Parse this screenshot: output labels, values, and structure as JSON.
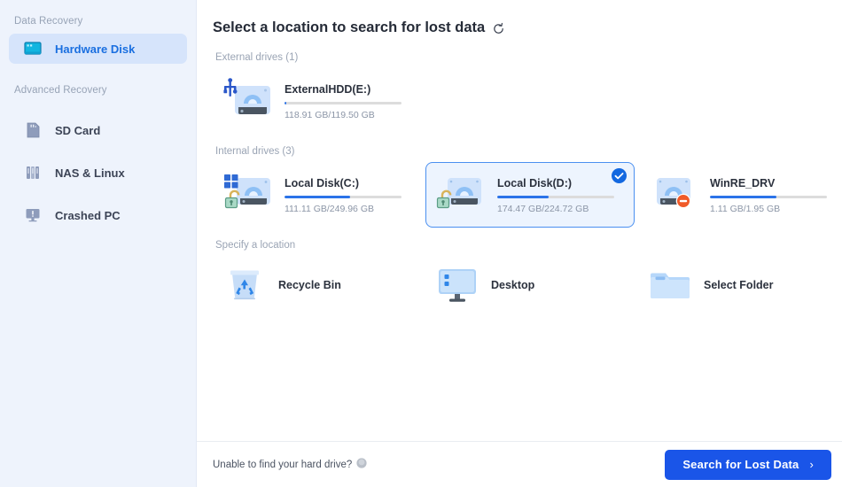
{
  "sidebar": {
    "groups": [
      {
        "label": "Data Recovery",
        "items": [
          {
            "label": "Hardware Disk",
            "icon": "hard-disk-icon",
            "active": true
          }
        ]
      },
      {
        "label": "Advanced Recovery",
        "items": [
          {
            "label": "SD Card",
            "icon": "sd-card-icon",
            "active": false
          },
          {
            "label": "NAS & Linux",
            "icon": "nas-icon",
            "active": false
          },
          {
            "label": "Crashed PC",
            "icon": "crashed-pc-icon",
            "active": false
          }
        ]
      }
    ]
  },
  "main": {
    "title": "Select a location to search for lost data",
    "refresh_icon": "refresh-icon",
    "sections": {
      "external_label": "External drives (1)",
      "internal_label": "Internal drives (3)",
      "specify_label": "Specify a location"
    },
    "external_drives": [
      {
        "name": "ExternalHDD(E:)",
        "capacity": "118.91 GB/119.50 GB",
        "fill_percent": 1,
        "icon": "external-usb-drive-icon",
        "badge": "usb-badge-icon",
        "selected": false
      }
    ],
    "internal_drives": [
      {
        "name": "Local Disk(C:)",
        "capacity": "111.11 GB/249.96 GB",
        "fill_percent": 56,
        "icon": "hard-drive-icon",
        "badge": "windows-logo-badge",
        "lock": "unlocked-padlock-icon",
        "selected": false
      },
      {
        "name": "Local Disk(D:)",
        "capacity": "174.47 GB/224.72 GB",
        "fill_percent": 44,
        "icon": "hard-drive-icon",
        "badge": "none",
        "lock": "unlocked-padlock-icon",
        "selected": true
      },
      {
        "name": "WinRE_DRV",
        "capacity": "1.11 GB/1.95 GB",
        "fill_percent": 57,
        "icon": "hard-drive-icon",
        "badge": "no-entry-badge-icon",
        "lock": "none",
        "selected": false
      }
    ],
    "locations": [
      {
        "label": "Recycle Bin",
        "icon": "recycle-bin-icon"
      },
      {
        "label": "Desktop",
        "icon": "desktop-monitor-icon"
      },
      {
        "label": "Select Folder",
        "icon": "folder-icon"
      }
    ]
  },
  "footer": {
    "help_text": "Unable to find your hard drive?",
    "help_icon": "help-circle-icon",
    "search_label": "Search for Lost Data",
    "search_chevron": "chevron-right-icon"
  },
  "colors": {
    "accent": "#1a55e8",
    "sidebar_bg": "#eef3fc",
    "sidebar_active": "#d6e4fb",
    "selected_card_border": "#4a8ff0",
    "selected_card_bg": "#edf4fe",
    "progress_fill": "#2b73e8",
    "annotation": "#d4501e"
  }
}
